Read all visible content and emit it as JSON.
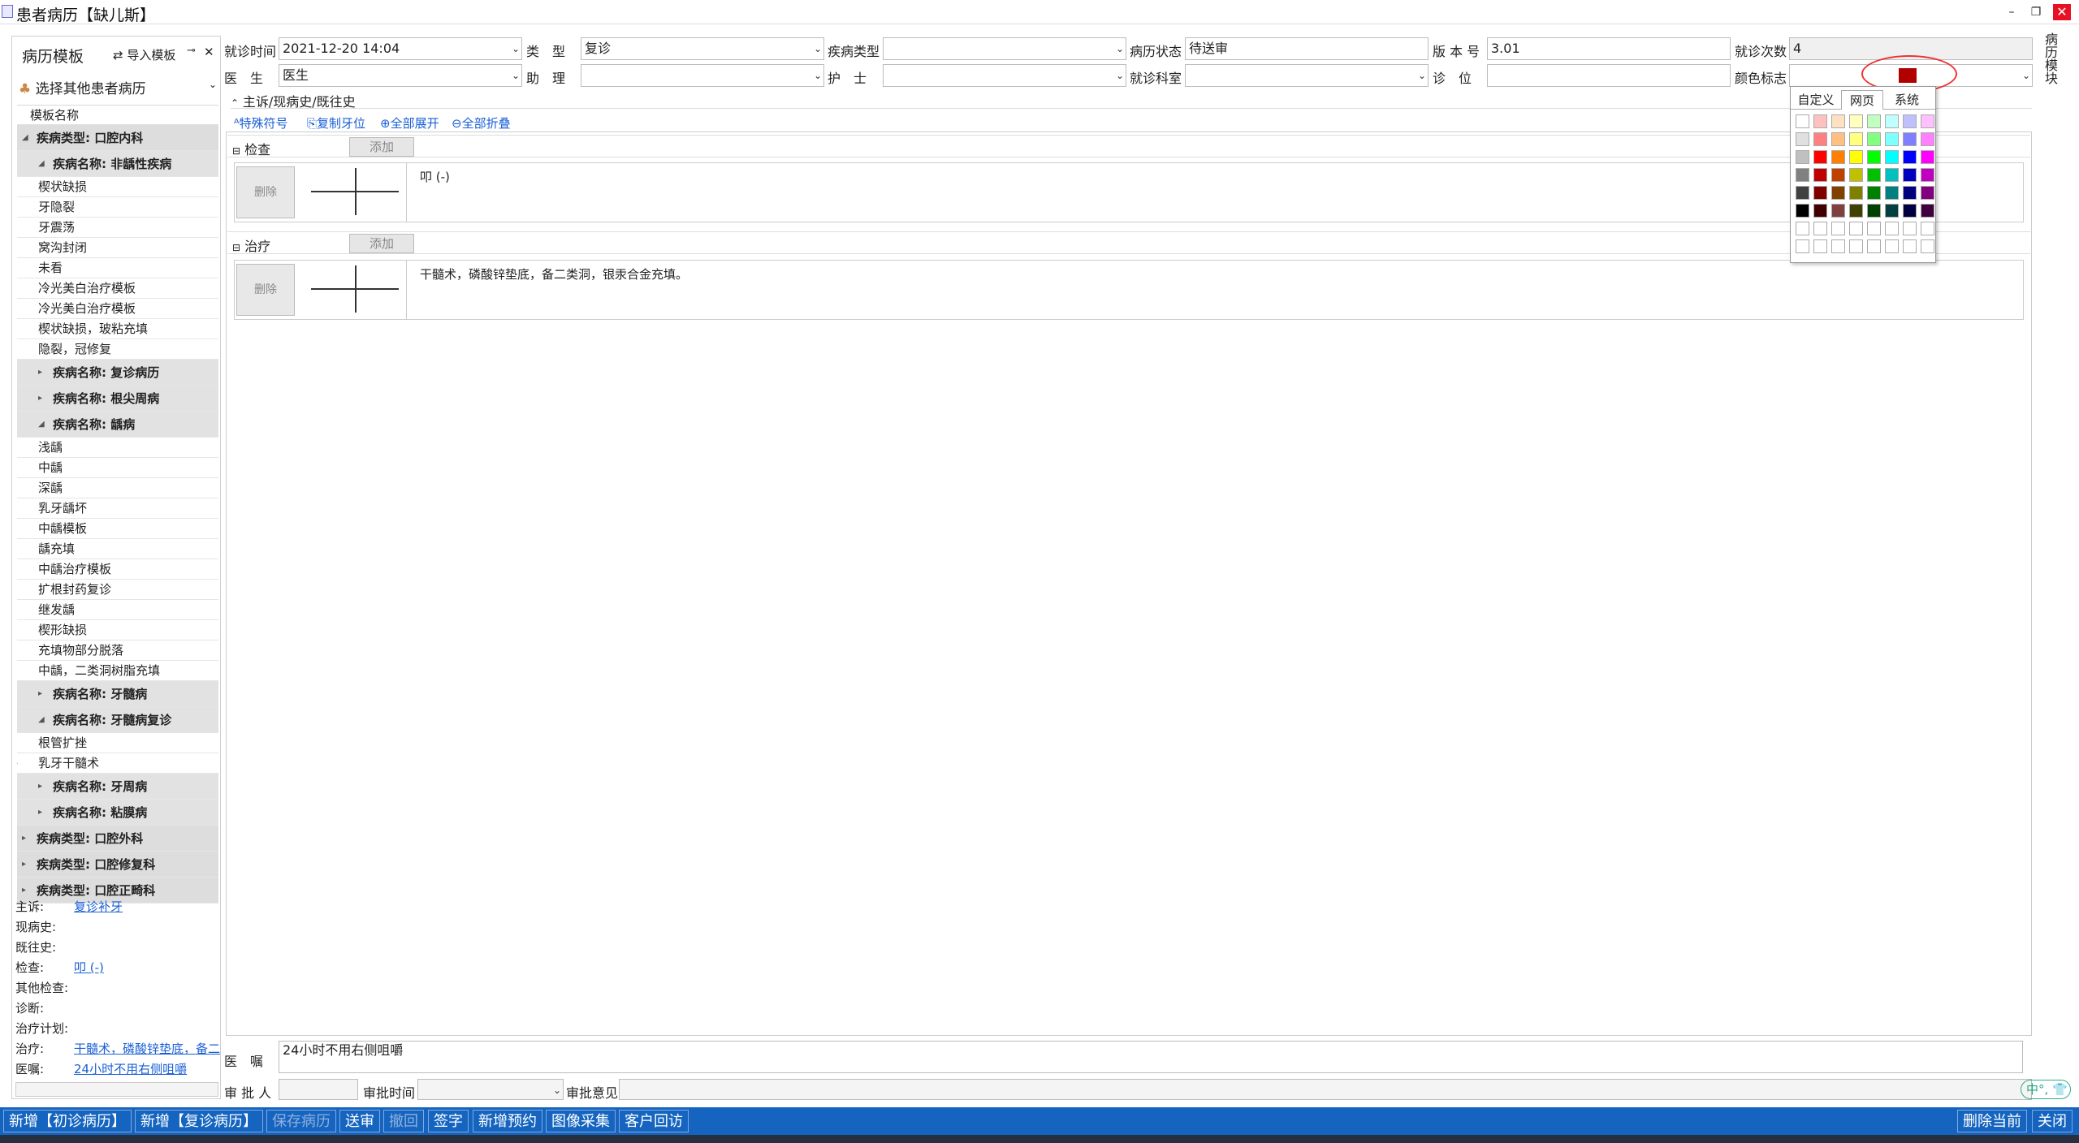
{
  "window": {
    "title": "患者病历【缺儿斯】",
    "minimize": "–",
    "restore": "❐",
    "close": "✕"
  },
  "left": {
    "title": "病历模板",
    "import_label": "导入模板",
    "select_other": "选择其他患者病历",
    "tree_header": "模板名称",
    "tree": [
      {
        "kind": "g1",
        "label": "疾病类型: 口腔内科",
        "open": true
      },
      {
        "kind": "g2",
        "label": "疾病名称: 非龋性疾病",
        "open": true
      },
      {
        "kind": "item",
        "label": "楔状缺损"
      },
      {
        "kind": "item",
        "label": "牙隐裂"
      },
      {
        "kind": "item",
        "label": "牙震荡"
      },
      {
        "kind": "item",
        "label": "窝沟封闭"
      },
      {
        "kind": "item",
        "label": "未看"
      },
      {
        "kind": "item",
        "label": "冷光美白治疗模板"
      },
      {
        "kind": "item",
        "label": "冷光美白治疗模板"
      },
      {
        "kind": "item",
        "label": "楔状缺损，玻粘充填"
      },
      {
        "kind": "item",
        "label": "隐裂，冠修复"
      },
      {
        "kind": "g2",
        "label": "疾病名称: 复诊病历",
        "open": false
      },
      {
        "kind": "g2",
        "label": "疾病名称: 根尖周病",
        "open": false
      },
      {
        "kind": "g2",
        "label": "疾病名称: 龋病",
        "open": true
      },
      {
        "kind": "item",
        "label": "浅龋"
      },
      {
        "kind": "item",
        "label": "中龋"
      },
      {
        "kind": "item",
        "label": "深龋"
      },
      {
        "kind": "item",
        "label": "乳牙龋坏"
      },
      {
        "kind": "item",
        "label": "中龋模板"
      },
      {
        "kind": "item",
        "label": "龋充填"
      },
      {
        "kind": "item",
        "label": "中龋治疗模板"
      },
      {
        "kind": "item",
        "label": "扩根封药复诊"
      },
      {
        "kind": "item",
        "label": "继发龋"
      },
      {
        "kind": "item",
        "label": "楔形缺损"
      },
      {
        "kind": "item",
        "label": "充填物部分脱落"
      },
      {
        "kind": "item",
        "label": "中龋，二类洞树脂充填"
      },
      {
        "kind": "g2",
        "label": "疾病名称: 牙髓病",
        "open": false
      },
      {
        "kind": "g2",
        "label": "疾病名称: 牙髓病复诊",
        "open": true
      },
      {
        "kind": "item",
        "label": "根管扩挫"
      },
      {
        "kind": "item",
        "label": "乳牙干髓术",
        "current": true
      },
      {
        "kind": "g2",
        "label": "疾病名称: 牙周病",
        "open": false
      },
      {
        "kind": "g2",
        "label": "疾病名称: 粘膜病",
        "open": false
      },
      {
        "kind": "g1",
        "label": "疾病类型: 口腔外科",
        "open": false
      },
      {
        "kind": "g1",
        "label": "疾病类型: 口腔修复科",
        "open": false
      },
      {
        "kind": "g1",
        "label": "疾病类型: 口腔正畸科",
        "open": false
      }
    ],
    "summary": [
      {
        "key": "主诉:",
        "value": "复诊补牙"
      },
      {
        "key": "现病史:",
        "value": ""
      },
      {
        "key": "既往史:",
        "value": ""
      },
      {
        "key": "检查:",
        "value": "叩 (-) "
      },
      {
        "key": "其他检查:",
        "value": ""
      },
      {
        "key": "诊断:",
        "value": ""
      },
      {
        "key": "治疗计划:",
        "value": ""
      },
      {
        "key": "治疗:",
        "value": "干髓术，磷酸锌垫底，备二类洞，银汞合金充填。"
      },
      {
        "key": "医嘱:",
        "value": "24小时不用右侧咀嚼"
      }
    ]
  },
  "form": {
    "visit_time_label": "就诊时间",
    "visit_time": "2021-12-20 14:04",
    "type_label": "类　型",
    "type": "复诊",
    "disease_type_label": "疾病类型",
    "disease_type": "",
    "record_status_label": "病历状态",
    "record_status": "待送审",
    "version_label": "版 本 号",
    "version": "3.01",
    "visit_count_label": "就诊次数",
    "visit_count": "4",
    "doctor_label": "医　生",
    "doctor": "医生",
    "assistant_label": "助　理",
    "assistant": "",
    "nurse_label": "护　士",
    "nurse": "",
    "dept_label": "就诊科室",
    "dept": "",
    "chair_label": "诊　位",
    "chair": "",
    "color_label": "颜色标志",
    "color_value": "#b00000"
  },
  "section": {
    "collapsed_header": "主诉/现病史/既往史",
    "tools": [
      "特殊符号",
      "复制牙位",
      "全部展开",
      "全部折叠"
    ],
    "exam_title": "检查",
    "treat_title": "治疗",
    "add": "添加",
    "delete": "删除",
    "exam_text": "叩 (-)",
    "treat_text": "干髓术，磷酸锌垫底，备二类洞，银汞合金充填。"
  },
  "picker": {
    "tabs": [
      "自定义",
      "网页",
      "系统"
    ],
    "active_tab": 1,
    "rows": [
      [
        "#ffffff",
        "#ffc0c0",
        "#ffe0c0",
        "#ffffc0",
        "#c0ffc0",
        "#c0ffff",
        "#c0c0ff",
        "#ffc0ff"
      ],
      [
        "#e0e0e0",
        "#ff8080",
        "#ffc080",
        "#ffff80",
        "#80ff80",
        "#80ffff",
        "#8080ff",
        "#ff80ff"
      ],
      [
        "#c0c0c0",
        "#ff0000",
        "#ff8000",
        "#ffff00",
        "#00ff00",
        "#00ffff",
        "#0000ff",
        "#ff00ff"
      ],
      [
        "#808080",
        "#c00000",
        "#c04000",
        "#c0c000",
        "#00c000",
        "#00c0c0",
        "#0000c0",
        "#c000c0"
      ],
      [
        "#404040",
        "#800000",
        "#804000",
        "#808000",
        "#008000",
        "#008080",
        "#000080",
        "#800080"
      ],
      [
        "#000000",
        "#400000",
        "#804040",
        "#404000",
        "#004000",
        "#004040",
        "#000040",
        "#400040"
      ],
      [
        "#ffffff",
        "#ffffff",
        "#ffffff",
        "#ffffff",
        "#ffffff",
        "#ffffff",
        "#ffffff",
        "#ffffff"
      ],
      [
        "#ffffff",
        "#ffffff",
        "#ffffff",
        "#ffffff",
        "#ffffff",
        "#ffffff",
        "#ffffff",
        "#ffffff"
      ]
    ]
  },
  "bottom": {
    "advice_label": "医　嘱",
    "advice": "24小时不用右侧咀嚼",
    "approver_label": "审 批 人",
    "approve_time_label": "审批时间",
    "approve_opinion_label": "审批意见",
    "ime": "中°,"
  },
  "toolbar": {
    "new_first": "新增【初诊病历】",
    "new_revisit": "新增【复诊病历】",
    "save": "保存病历",
    "submit": "送审",
    "withdraw": "撤回",
    "sign": "签字",
    "new_appt": "新增预约",
    "image": "图像采集",
    "followup": "客户回访",
    "delete_current": "删除当前",
    "close": "关闭"
  },
  "right_dock": "病历模块",
  "colors": {
    "toolbar": "#1565c0",
    "link": "#1a5fd6",
    "accent_red": "#e33333"
  }
}
